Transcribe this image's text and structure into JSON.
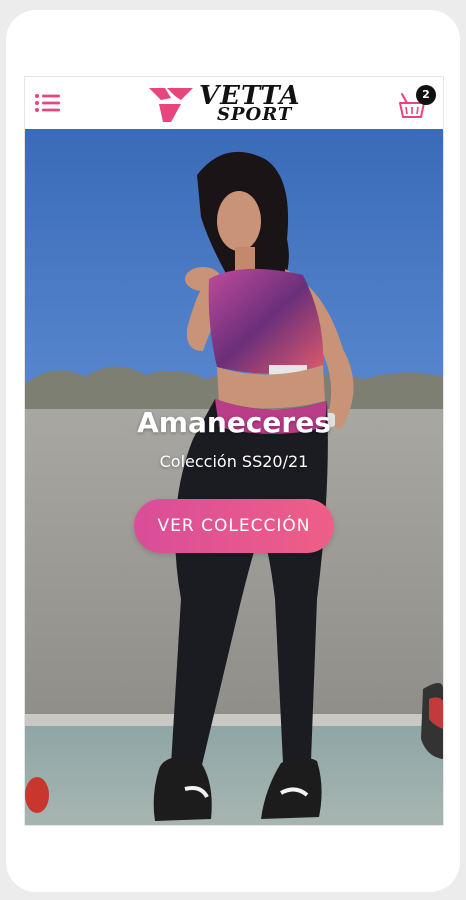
{
  "header": {
    "menu_icon": "hamburger-menu-icon",
    "logo": {
      "line1": "VETTA",
      "line2": "SPORT",
      "mark_color": "#e8457f"
    },
    "cart": {
      "icon": "shopping-basket-icon",
      "count": "2",
      "icon_color": "#e8457f"
    }
  },
  "hero": {
    "title": "Amaneceres",
    "subtitle": "Colección SS20/21",
    "cta_label": "VER COLECCIÓN",
    "cta_gradient": [
      "#d94d9a",
      "#ee5f86"
    ]
  },
  "colors": {
    "accent": "#e8457f",
    "frame": "#ececec"
  }
}
